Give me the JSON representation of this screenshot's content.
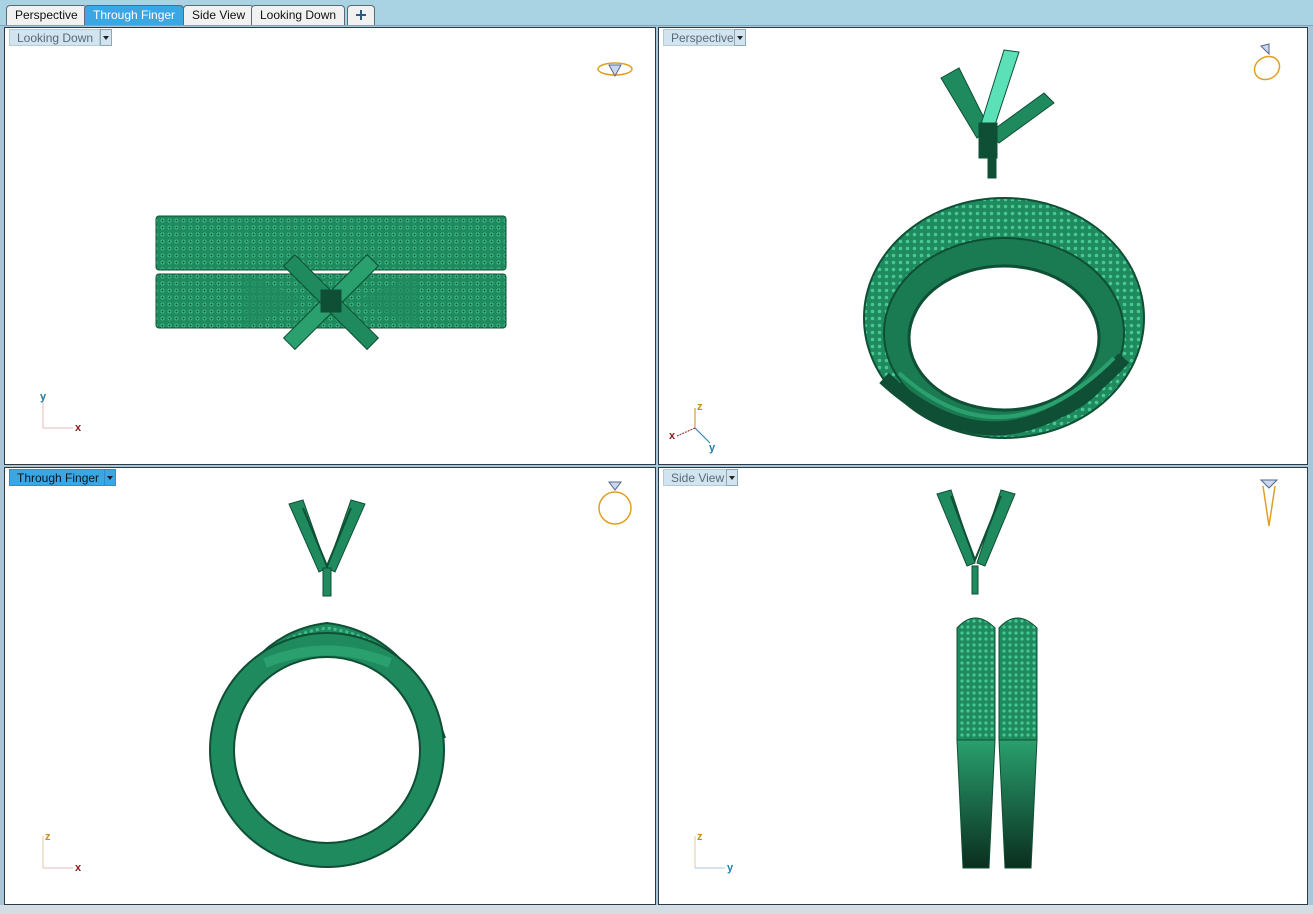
{
  "tabs": [
    {
      "label": "Perspective",
      "active": false
    },
    {
      "label": "Through Finger",
      "active": true
    },
    {
      "label": "Side View",
      "active": false
    },
    {
      "label": "Looking Down",
      "active": false
    }
  ],
  "add_tab_icon": "plus-icon",
  "viewports": {
    "top_left": {
      "label": "Looking Down",
      "active": false,
      "axes": [
        "y",
        "x"
      ]
    },
    "top_right": {
      "label": "Perspective",
      "active": false,
      "axes": [
        "z",
        "x",
        "y"
      ]
    },
    "bottom_left": {
      "label": "Through Finger",
      "active": true,
      "axes": [
        "z",
        "x"
      ]
    },
    "bottom_right": {
      "label": "Side View",
      "active": false,
      "axes": [
        "z",
        "y"
      ]
    }
  },
  "colors": {
    "model_green": "#1f8a5e",
    "model_dark": "#0e4f35",
    "model_light": "#3fbf8b",
    "active_tab": "#3aa7e3",
    "axis_x": "#8b1a1a",
    "axis_y": "#1e7fa8",
    "axis_z": "#c98a18",
    "widget_gold": "#e0a020"
  }
}
